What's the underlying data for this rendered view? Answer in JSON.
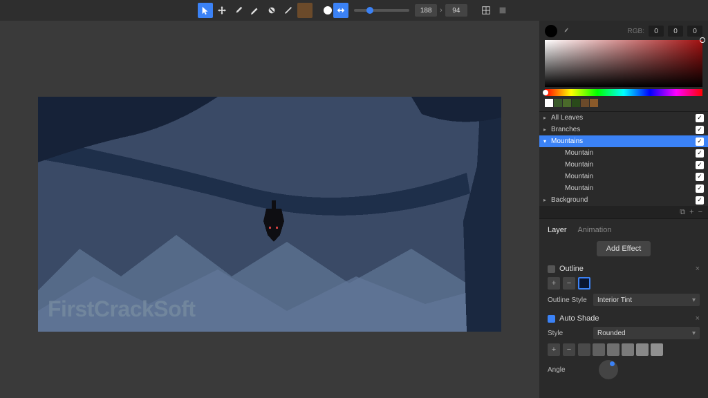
{
  "toolbar": {
    "coord_x": "188",
    "coord_y": "94",
    "swatch_color": "#6b4a2a"
  },
  "color_panel": {
    "rgb_label": "RGB:",
    "r": "0",
    "g": "0",
    "b": "0",
    "palette": [
      "#ffffff",
      "#3a5a2a",
      "#4a6a2a",
      "#2a4a1a",
      "#6b4a2a",
      "#8a5a2a"
    ]
  },
  "layers": [
    {
      "label": "All Leaves",
      "expanded": true,
      "indent": 0,
      "checked": true
    },
    {
      "label": "Branches",
      "expanded": true,
      "indent": 0,
      "checked": true
    },
    {
      "label": "Mountains",
      "expanded": false,
      "indent": 0,
      "selected": true,
      "checked": true
    },
    {
      "label": "Mountain",
      "indent": 1,
      "checked": true
    },
    {
      "label": "Mountain",
      "indent": 1,
      "checked": true
    },
    {
      "label": "Mountain",
      "indent": 1,
      "checked": true
    },
    {
      "label": "Mountain",
      "indent": 1,
      "checked": true
    },
    {
      "label": "Background",
      "indent": 0,
      "checked": true
    }
  ],
  "props": {
    "tab_layer": "Layer",
    "tab_animation": "Animation",
    "add_effect": "Add Effect",
    "outline": {
      "title": "Outline",
      "style_label": "Outline Style",
      "style_value": "Interior Tint"
    },
    "auto_shade": {
      "title": "Auto Shade",
      "style_label": "Style",
      "style_value": "Rounded",
      "angle_label": "Angle",
      "shades": [
        "#4a4a4a",
        "#606060",
        "#707070",
        "#7a7a7a",
        "#888888",
        "#909090"
      ]
    }
  },
  "watermark": "FirstCrackSoft"
}
